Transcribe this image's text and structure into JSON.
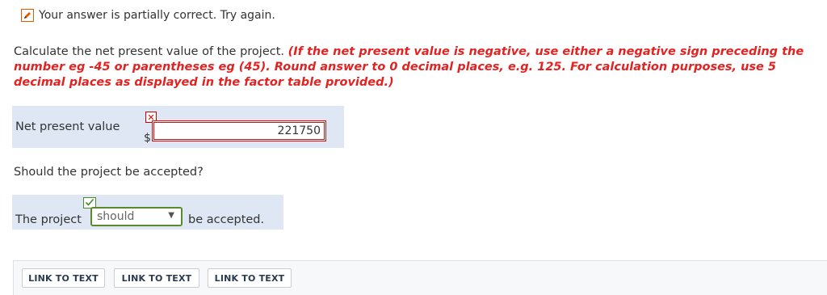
{
  "status": {
    "icon": "pencil-icon",
    "message": "Your answer is partially correct.  Try again.",
    "icon_color": "#e05a00"
  },
  "question": {
    "text": "Calculate the net present value of the project.",
    "note": "(If the net present value is negative, use either a negative sign preceding the number eg -45 or parentheses eg (45). Round answer to 0 decimal places, e.g. 125. For calculation purposes, use 5 decimal places as displayed in the factor table provided.)",
    "note_color": "#e32222"
  },
  "npv": {
    "label": "Net present value",
    "currency": "$",
    "value": "221750",
    "status_icon": "x-mark-icon",
    "status_color": "#cc1111"
  },
  "accept_question": "Should the project be accepted?",
  "accept": {
    "prefix": "The project",
    "selected": "should",
    "suffix": "be accepted.",
    "status_icon": "checkmark-icon",
    "status_color": "#5b8a2e"
  },
  "footer": {
    "links": [
      "LINK TO TEXT",
      "LINK TO TEXT",
      "LINK TO TEXT"
    ]
  }
}
